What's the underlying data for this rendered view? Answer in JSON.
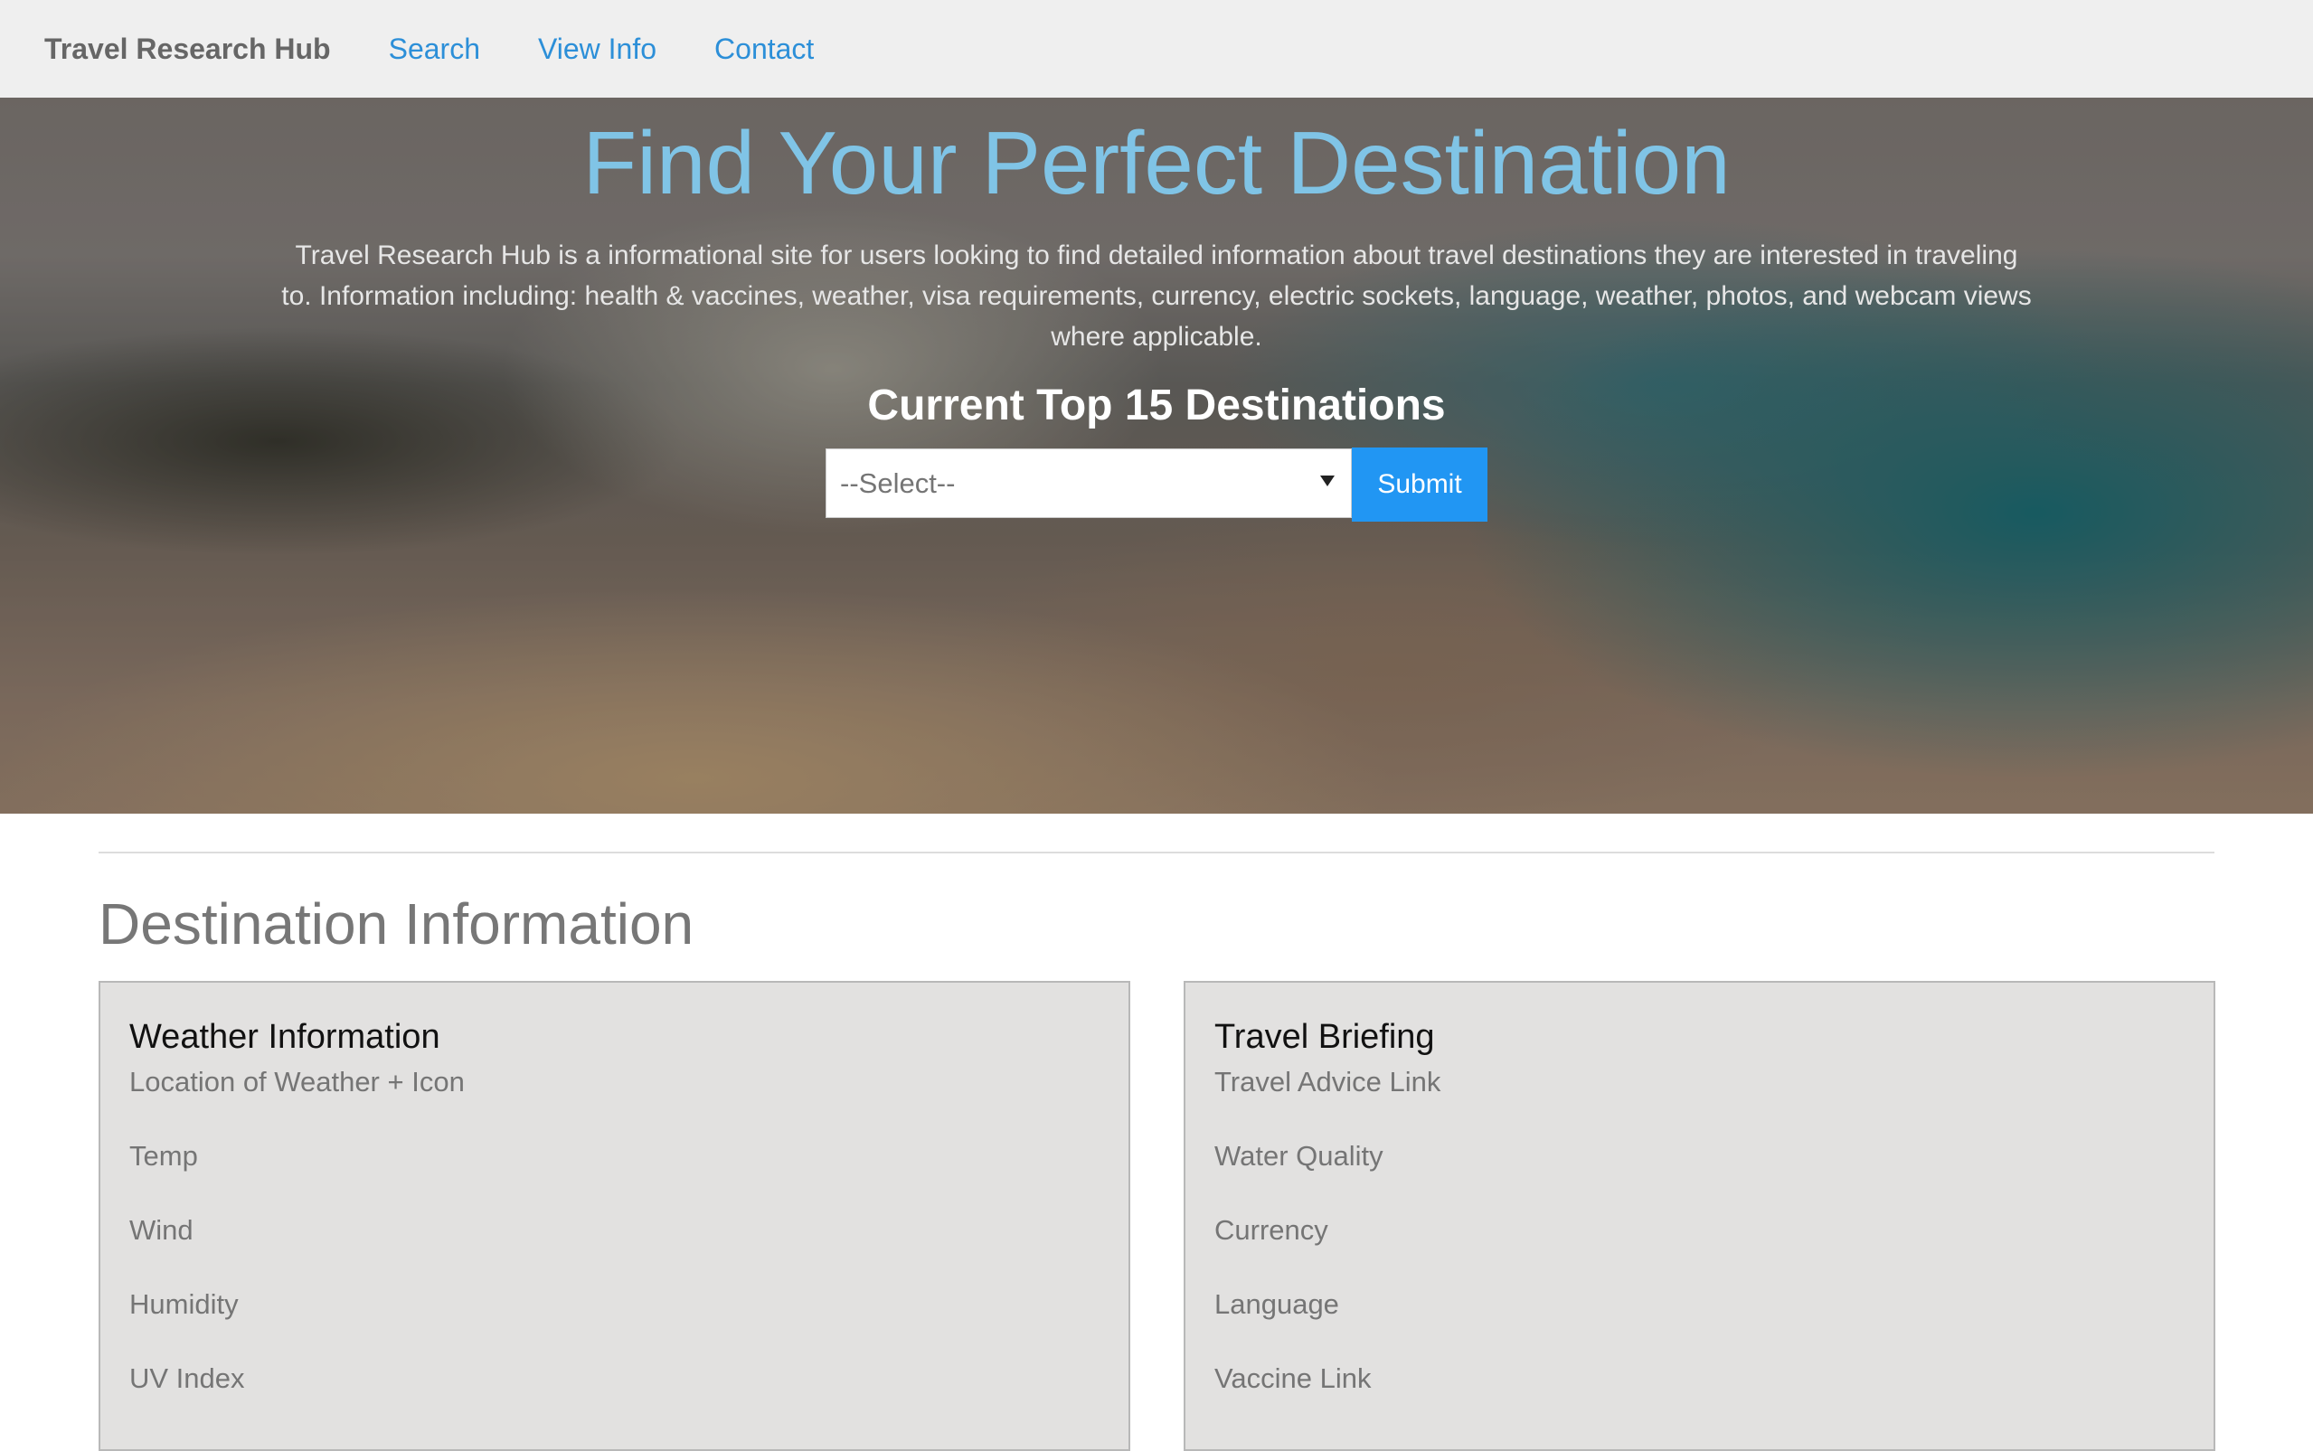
{
  "navbar": {
    "brand": "Travel Research Hub",
    "links": [
      "Search",
      "View Info",
      "Contact"
    ]
  },
  "hero": {
    "title": "Find Your Perfect Destination",
    "description": "Travel Research Hub is a informational site for users looking to find detailed information about travel destinations they are interested in traveling to. Information including: health & vaccines, weather, visa requirements, currency, electric sockets, language, weather, photos, and webcam views where applicable.",
    "subtitle": "Current Top 15 Destinations",
    "select_value": "--Select--",
    "submit_label": "Submit"
  },
  "main": {
    "section_title": "Destination Information",
    "weather_card": {
      "title": "Weather Information",
      "items": [
        "Location of Weather + Icon",
        "Temp",
        "Wind",
        "Humidity",
        "UV Index"
      ]
    },
    "briefing_card": {
      "title": "Travel Briefing",
      "items": [
        "Travel Advice Link",
        "Water Quality",
        "Currency",
        "Language",
        "Vaccine Link"
      ]
    }
  },
  "colors": {
    "navbar_bg": "#efefef",
    "link": "#2c8fd8",
    "hero_title": "#80c4e6",
    "submit_bg": "#2196f3",
    "card_bg": "#e2e1e0"
  },
  "icons": {
    "select_arrow": "dropdown-arrow-icon"
  }
}
